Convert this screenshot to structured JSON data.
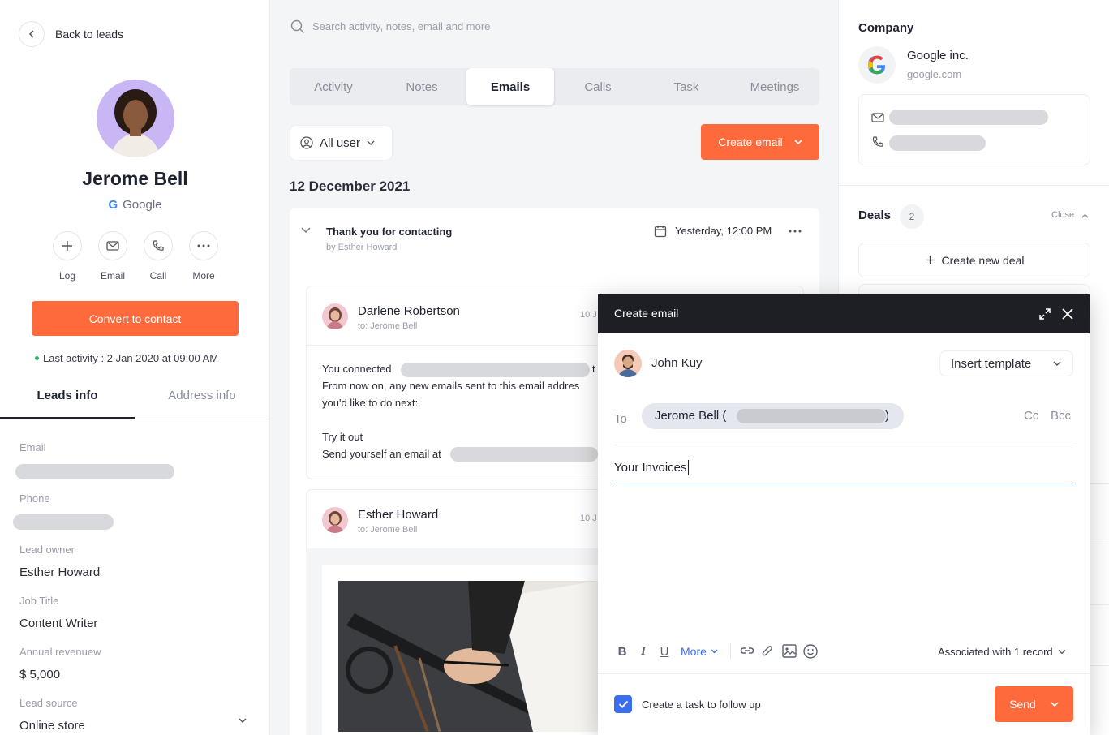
{
  "left": {
    "back_label": "Back to leads",
    "name": "Jerome Bell",
    "company": "Google",
    "actions": [
      {
        "label": "Log",
        "icon": "plus-icon"
      },
      {
        "label": "Email",
        "icon": "mail-icon"
      },
      {
        "label": "Call",
        "icon": "phone-icon"
      },
      {
        "label": "More",
        "icon": "more-dots-icon"
      }
    ],
    "convert_label": "Convert to contact",
    "last_activity": "Last activity : 2 Jan 2020 at 09:00 AM",
    "tabs": [
      "Leads info",
      "Address info"
    ],
    "fields": {
      "email_label": "Email",
      "phone_label": "Phone",
      "owner_label": "Lead owner",
      "owner_value": "Esther Howard",
      "job_label": "Job Title",
      "job_value": "Content Writer",
      "revenue_label": "Annual revenuew",
      "revenue_value": "$ 5,000",
      "source_label": "Lead source",
      "source_value": "Online store"
    }
  },
  "mid": {
    "search_placeholder": "Search activity, notes, email and more",
    "tabs": [
      "Activity",
      "Notes",
      "Emails",
      "Calls",
      "Task",
      "Meetings"
    ],
    "active_tab": "Emails",
    "filter_label": "All user",
    "create_label": "Create email",
    "date_heading": "12 December 2021",
    "thread": {
      "subject": "Thank you for contacting",
      "by": "by Esther Howard",
      "time": "Yesterday, 12:00 PM"
    },
    "emails": [
      {
        "sender": "Darlene Robertson",
        "to": "to: Jerome Bell",
        "date": "10 J"
      },
      {
        "sender": "Esther Howard",
        "to": "to: Jerome Bell",
        "date": "10 J"
      }
    ],
    "body": {
      "line1": "You connected",
      "line1_end": "t",
      "line2": "From now on, any new emails sent to this email addres",
      "line3": "you'd like to do next:",
      "line4": "Try it out",
      "line5": "Send yourself an email at"
    }
  },
  "right": {
    "company_heading": "Company",
    "company_name": "Google inc.",
    "company_domain": "google.com",
    "deals_label": "Deals",
    "deals_count": "2",
    "close_label": "Close",
    "new_deal_label": "Create new deal"
  },
  "modal": {
    "title": "Create email",
    "from_name": "John Kuy",
    "template_label": "Insert template",
    "to_label": "To",
    "to_chip_name": "Jerome Bell (",
    "to_chip_close": ")",
    "cc_label": "Cc",
    "bcc_label": "Bcc",
    "subject": "Your Invoices",
    "more_label": "More",
    "associated_label": "Associated with 1 record",
    "followup_label": "Create a task to follow up",
    "send_label": "Send"
  },
  "colors": {
    "accent": "#ff6a3d",
    "dark": "#1d1f24",
    "link": "#3a6df0",
    "avatar_purple": "#c9b6f5"
  }
}
